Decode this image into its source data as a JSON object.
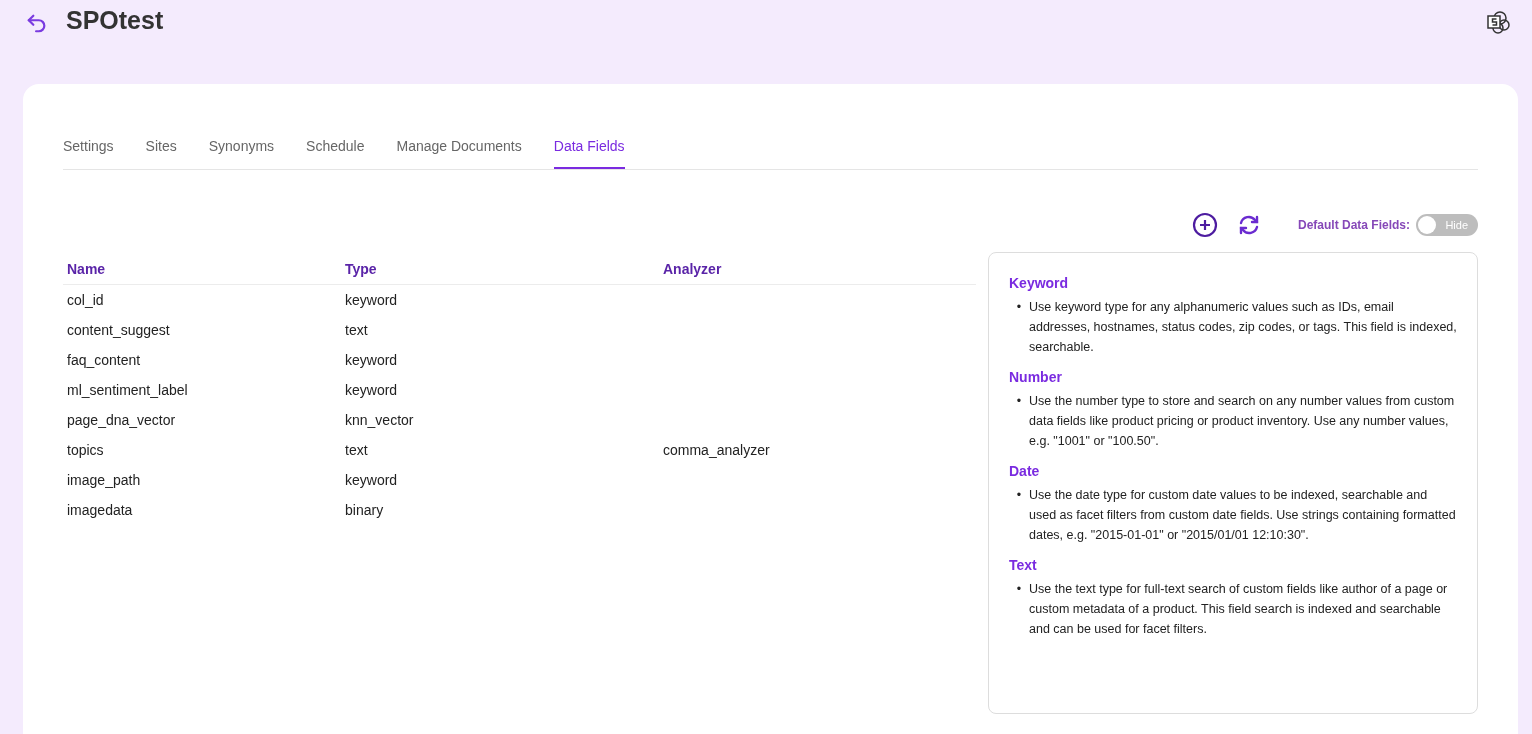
{
  "header": {
    "title": "SPOtest"
  },
  "tabs": [
    {
      "label": "Settings",
      "selected": false
    },
    {
      "label": "Sites",
      "selected": false
    },
    {
      "label": "Synonyms",
      "selected": false
    },
    {
      "label": "Schedule",
      "selected": false
    },
    {
      "label": "Manage Documents",
      "selected": false
    },
    {
      "label": "Data Fields",
      "selected": true
    }
  ],
  "toolbar": {
    "toggle_label": "Default Data Fields:",
    "toggle": {
      "on": false,
      "text": "Hide"
    }
  },
  "table": {
    "columns": [
      "Name",
      "Type",
      "Analyzer"
    ],
    "rows": [
      [
        "col_id",
        "keyword",
        ""
      ],
      [
        "content_suggest",
        "text",
        ""
      ],
      [
        "faq_content",
        "keyword",
        ""
      ],
      [
        "ml_sentiment_label",
        "keyword",
        ""
      ],
      [
        "page_dna_vector",
        "knn_vector",
        ""
      ],
      [
        "topics",
        "text",
        "comma_analyzer"
      ],
      [
        "image_path",
        "keyword",
        ""
      ],
      [
        "imagedata",
        "binary",
        ""
      ]
    ]
  },
  "help": [
    {
      "title": "Keyword",
      "bullet": "•",
      "text": "Use keyword type for any alphanumeric values such as IDs, email addresses, hostnames, status codes, zip codes, or tags. This field is indexed, searchable."
    },
    {
      "title": "Number",
      "bullet": "•",
      "text": "Use the number type to store and search on any number values from custom data fields like product pricing or product inventory. Use any number values, e.g. \"1001\" or \"100.50\"."
    },
    {
      "title": "Date",
      "bullet": "•",
      "text": "Use the date type for custom date values to be indexed, searchable and used as facet filters from custom date fields. Use strings containing formatted dates, e.g. \"2015-01-01\" or \"2015/01/01 12:10:30\"."
    },
    {
      "title": "Text",
      "bullet": "•",
      "text": "Use the text type for full-text search of custom fields like author of a page or custom metadata of a product. This field search is indexed and searchable and can be used for facet filters."
    }
  ]
}
